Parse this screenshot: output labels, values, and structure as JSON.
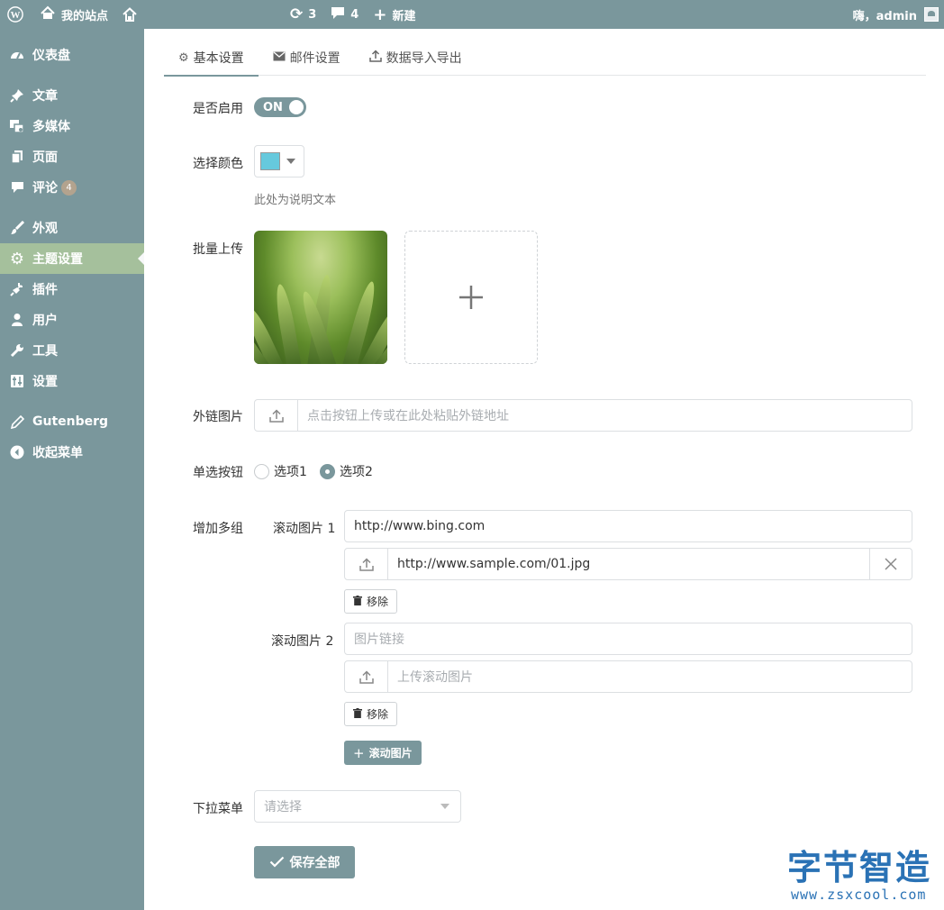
{
  "adminbar": {
    "site_name": "我的站点",
    "updates_count": "3",
    "comments_count": "4",
    "new_label": "新建",
    "greeting": "嗨，admin"
  },
  "sidebar": {
    "items": [
      {
        "label": "仪表盘",
        "icon": "dashboard-icon"
      },
      {
        "label": "文章",
        "icon": "pin-icon"
      },
      {
        "label": "多媒体",
        "icon": "media-icon"
      },
      {
        "label": "页面",
        "icon": "page-icon"
      },
      {
        "label": "评论",
        "icon": "comment-icon",
        "badge": "4"
      },
      {
        "label": "外观",
        "icon": "brush-icon"
      },
      {
        "label": "主题设置",
        "icon": "gear-icon",
        "active": true
      },
      {
        "label": "插件",
        "icon": "plug-icon"
      },
      {
        "label": "用户",
        "icon": "user-icon"
      },
      {
        "label": "工具",
        "icon": "wrench-icon"
      },
      {
        "label": "设置",
        "icon": "settings-icon"
      },
      {
        "label": "Gutenberg",
        "icon": "pencil-icon"
      },
      {
        "label": "收起菜单",
        "icon": "collapse-icon"
      }
    ]
  },
  "tabs": [
    {
      "label": "基本设置",
      "active": true
    },
    {
      "label": "邮件设置"
    },
    {
      "label": "数据导入导出"
    }
  ],
  "form": {
    "enable": {
      "label": "是否启用",
      "state": "ON"
    },
    "color": {
      "label": "选择颜色",
      "value": "#66c9dd",
      "help": "此处为说明文本"
    },
    "batch_upload": {
      "label": "批量上传"
    },
    "external_image": {
      "label": "外链图片",
      "placeholder": "点击按钮上传或在此处粘贴外链地址"
    },
    "radio": {
      "label": "单选按钮",
      "options": [
        "选项1",
        "选项2"
      ],
      "selected": "选项2"
    },
    "groups": {
      "label": "增加多组",
      "items": [
        {
          "label": "滚动图片 1",
          "link": "http://www.bing.com",
          "image": "http://www.sample.com/01.jpg",
          "remove": "移除"
        },
        {
          "label": "滚动图片 2",
          "link_placeholder": "图片链接",
          "image_placeholder": "上传滚动图片",
          "remove": "移除"
        }
      ],
      "add_label": "滚动图片"
    },
    "dropdown": {
      "label": "下拉菜单",
      "placeholder": "请选择"
    },
    "save_label": "保存全部"
  },
  "watermark": {
    "title": "字节智造",
    "url": "www.zsxcool.com"
  }
}
